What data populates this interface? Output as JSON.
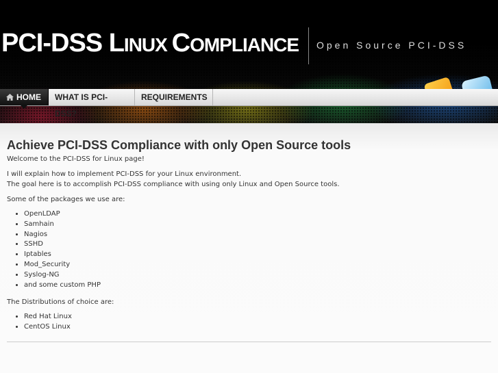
{
  "header": {
    "title_parts": [
      {
        "text": "PCI-DSS ",
        "size": "big"
      },
      {
        "text": "L",
        "size": "big"
      },
      {
        "text": "INUX ",
        "size": "small"
      },
      {
        "text": "C",
        "size": "big"
      },
      {
        "text": "OMPLIANCE",
        "size": "small"
      }
    ],
    "tagline": "Open Source PCI-DSS"
  },
  "nav": {
    "items": [
      {
        "label": "HOME",
        "active": true
      },
      {
        "label": "WHAT IS PCI-DSS?",
        "active": false
      },
      {
        "label": "REQUIREMENTS",
        "active": false
      }
    ]
  },
  "main": {
    "heading": "Achieve PCI-DSS Compliance with only Open Source tools",
    "welcome": "Welcome to the PCI-DSS for Linux page!",
    "intro_line1": "I will explain how to implement PCI-DSS for your Linux environment.",
    "intro_line2": "The goal here is to accomplish PCI-DSS compliance with using only Linux and Open Source tools.",
    "packages_intro": "Some of the packages we use are:",
    "packages": [
      "OpenLDAP",
      "Samhain",
      "Nagios",
      "SSHD",
      "Iptables",
      "Mod_Security",
      "Syslog-NG",
      "and some custom PHP"
    ],
    "distros_intro": "The Distributions of choice are:",
    "distros": [
      "Red Hat Linux",
      "CentOS Linux"
    ]
  },
  "colors": {
    "nav_active_bg": "#111111",
    "heading_text": "#333333"
  },
  "icons": [
    "home-icon",
    "rss-icon",
    "share-icon"
  ]
}
